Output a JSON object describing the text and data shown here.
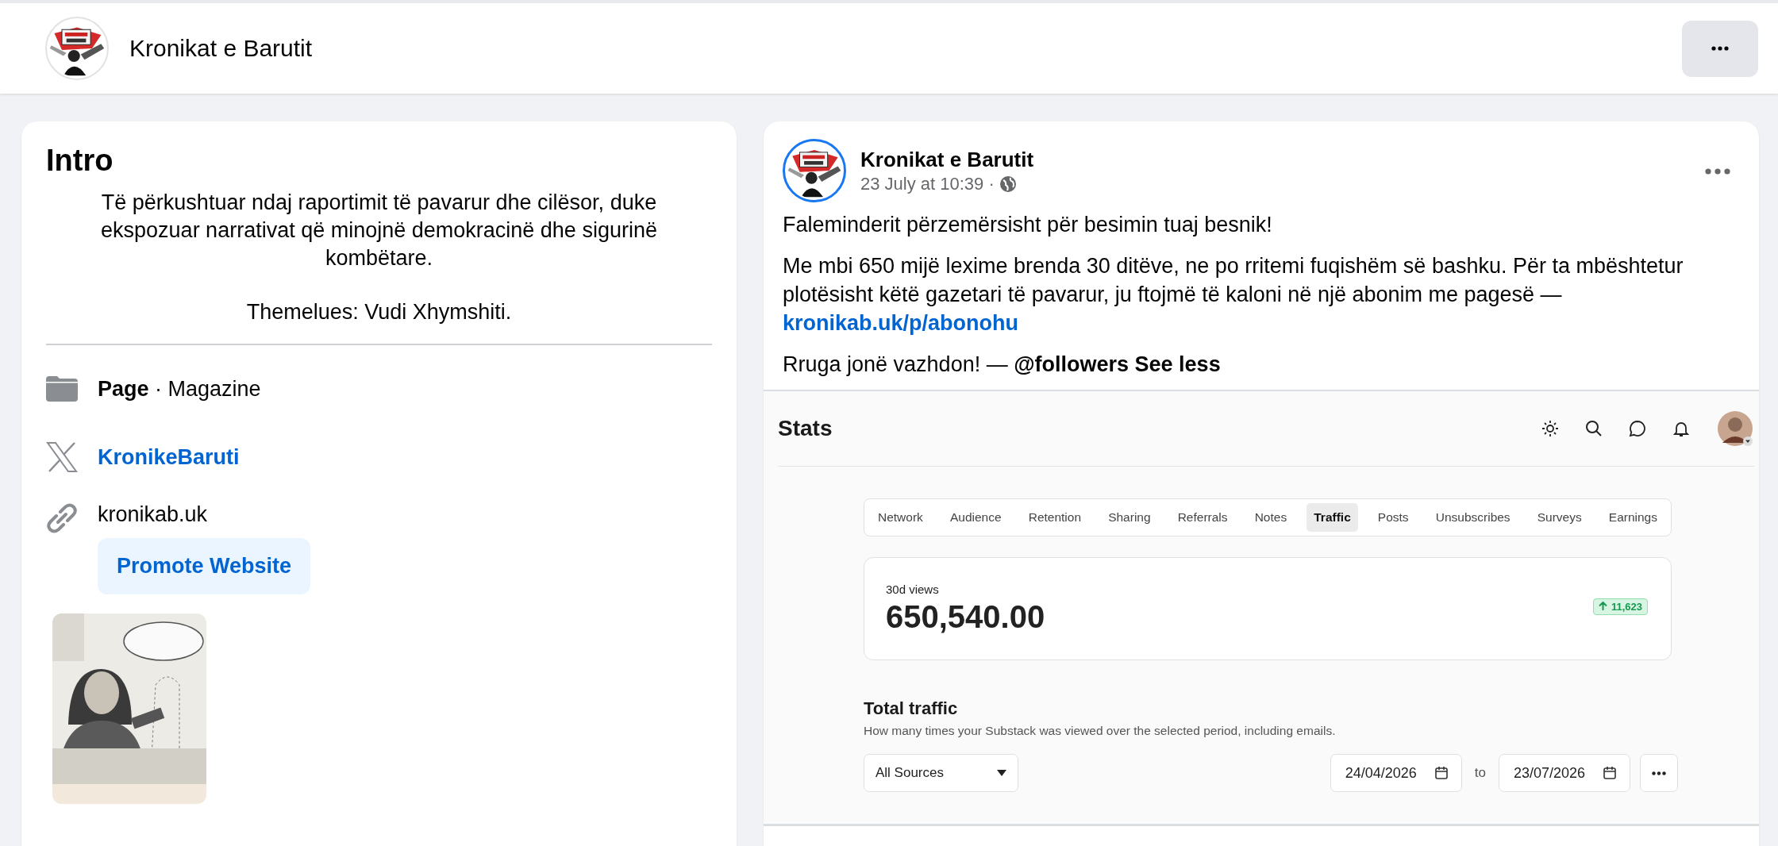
{
  "header": {
    "page_name": "Kronikat e Barutit"
  },
  "intro": {
    "title": "Intro",
    "bio": "Të përkushtuar ndaj raportimit të pavarur dhe cilësor, duke ekspozuar narrativat që minojnë demokracinë dhe sigurinë kombëtare.",
    "founder": "Themelues: Vudi Xhymshiti.",
    "details": [
      {
        "kind": "category",
        "label": "Page",
        "value": "· Magazine"
      },
      {
        "kind": "x",
        "text": "KronikeBaruti"
      },
      {
        "kind": "website",
        "text": "kronikab.uk",
        "button": "Promote Website"
      }
    ]
  },
  "post": {
    "author": "Kronikat e Barutit",
    "time": "23 July at 10:39 ·",
    "paragraphs": [
      {
        "text": "Faleminderit përzemërsisht për besimin tuaj besnik!"
      },
      {
        "text": "Me mbi 650 mijë lexime brenda 30 ditëve, ne po rritemi fuqishëm së bashku. Për ta mbështetur plotësisht këtë gazetari të pavarur, ju ftojmë të kaloni në një abonim me pagesë —",
        "link": "kronikab.uk/p/abonohu"
      },
      {
        "text": "Rruga jonë vazhdon! — **@followers**",
        "action": "See less"
      }
    ]
  },
  "stats": {
    "title": "Stats",
    "tabs": [
      {
        "label": "Network",
        "selected": false
      },
      {
        "label": "Audience",
        "selected": false
      },
      {
        "label": "Retention",
        "selected": false
      },
      {
        "label": "Sharing",
        "selected": false
      },
      {
        "label": "Referrals",
        "selected": false
      },
      {
        "label": "Notes",
        "selected": false
      },
      {
        "label": "Traffic",
        "selected": true
      },
      {
        "label": "Posts",
        "selected": false
      },
      {
        "label": "Unsubscribes",
        "selected": false
      },
      {
        "label": "Surveys",
        "selected": false
      },
      {
        "label": "Earnings",
        "selected": false
      }
    ],
    "metric": {
      "label": "30d views",
      "value": "650,540.00",
      "change": "11,623"
    },
    "section": {
      "title": "Total traffic",
      "description": "How many times your Substack was viewed over the selected period, including emails."
    },
    "source": "All Sources",
    "date_from": "24/04/2026",
    "to": "to",
    "date_to": "23/07/2026"
  }
}
